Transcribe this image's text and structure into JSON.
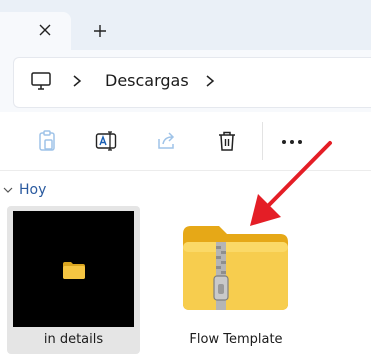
{
  "titlebar": {
    "tab_close_icon": "close-icon",
    "new_tab_icon": "plus-icon"
  },
  "address": {
    "root_icon": "monitor-icon",
    "breadcrumb": [
      "Descargas"
    ],
    "chevron_icon": "chevron-right-icon"
  },
  "toolbar": {
    "buttons": [
      {
        "icon": "paste-icon",
        "enabled": false
      },
      {
        "icon": "rename-icon",
        "enabled": true
      },
      {
        "icon": "share-icon",
        "enabled": false
      },
      {
        "icon": "delete-icon",
        "enabled": true
      },
      {
        "icon": "more-icon",
        "enabled": true
      }
    ]
  },
  "content": {
    "group_label": "Hoy",
    "items": [
      {
        "name": "in details",
        "type": "video-thumbnail",
        "selected": true
      },
      {
        "name": "Flow Template",
        "type": "zip-folder",
        "selected": false
      }
    ]
  },
  "colors": {
    "accent": "#2a5a9f",
    "annotation_arrow": "#e41e26",
    "folder": "#f5c542"
  }
}
